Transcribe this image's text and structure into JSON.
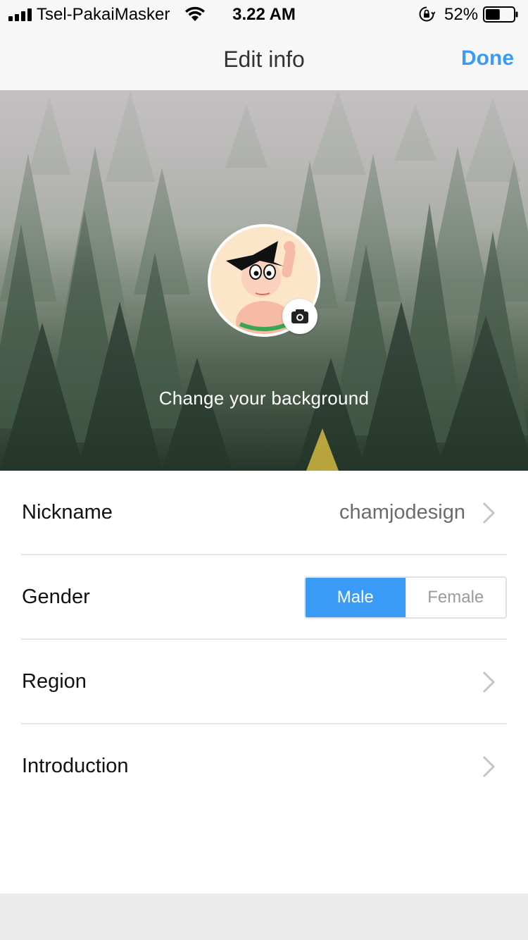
{
  "status_bar": {
    "carrier": "Tsel-PakaiMasker",
    "time": "3.22 AM",
    "battery_percent": "52%",
    "battery_level": 0.52
  },
  "nav": {
    "title": "Edit info",
    "done_label": "Done"
  },
  "header": {
    "change_background_label": "Change your background"
  },
  "fields": {
    "nickname_label": "Nickname",
    "nickname_value": "chamjodesign",
    "gender_label": "Gender",
    "gender_options": [
      "Male",
      "Female"
    ],
    "gender_selected": "Male",
    "region_label": "Region",
    "introduction_label": "Introduction"
  },
  "colors": {
    "accent": "#3a9bf7",
    "nav_background": "#f7f7f7",
    "footer_background": "#ebebeb"
  },
  "icons": {
    "signal": "cellular-signal-icon",
    "wifi": "wifi-icon",
    "rotation_lock": "rotation-lock-icon",
    "battery": "battery-icon",
    "camera": "camera-icon",
    "chevron": "chevron-right-icon"
  }
}
